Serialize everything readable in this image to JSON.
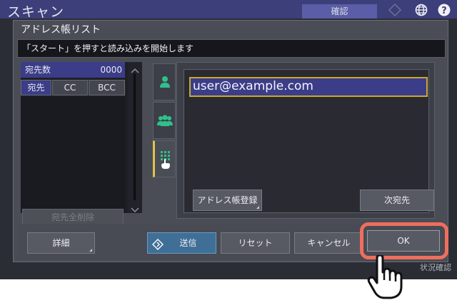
{
  "app": {
    "title": "スキャン",
    "confirm_label": "確認"
  },
  "dialog": {
    "title": "アドレス帳リスト",
    "message": "「スタート」を押すと読み込みを開始します"
  },
  "recipients": {
    "count_label": "宛先数",
    "count_value": "0000",
    "tabs": [
      "宛先",
      "CC",
      "BCC"
    ],
    "delete_all_label": "宛先全削除"
  },
  "entry": {
    "address": "user@example.com",
    "register_label": "アドレス帳登録",
    "next_label": "次宛先"
  },
  "footer": {
    "details_label": "詳細",
    "send_label": "送信",
    "reset_label": "リセット",
    "cancel_label": "キャンセル",
    "ok_label": "OK",
    "status_label": "状況確認"
  },
  "icons": [
    "globe-icon",
    "help-icon",
    "single-user-icon",
    "group-icon",
    "keypad-icon",
    "send-diamond-icon",
    "pointing-hand-icon"
  ],
  "colors": {
    "accent": "#3b3d88",
    "highlight": "#ee6f5c",
    "selection": "#c9a834",
    "send": "#3f6f96"
  }
}
